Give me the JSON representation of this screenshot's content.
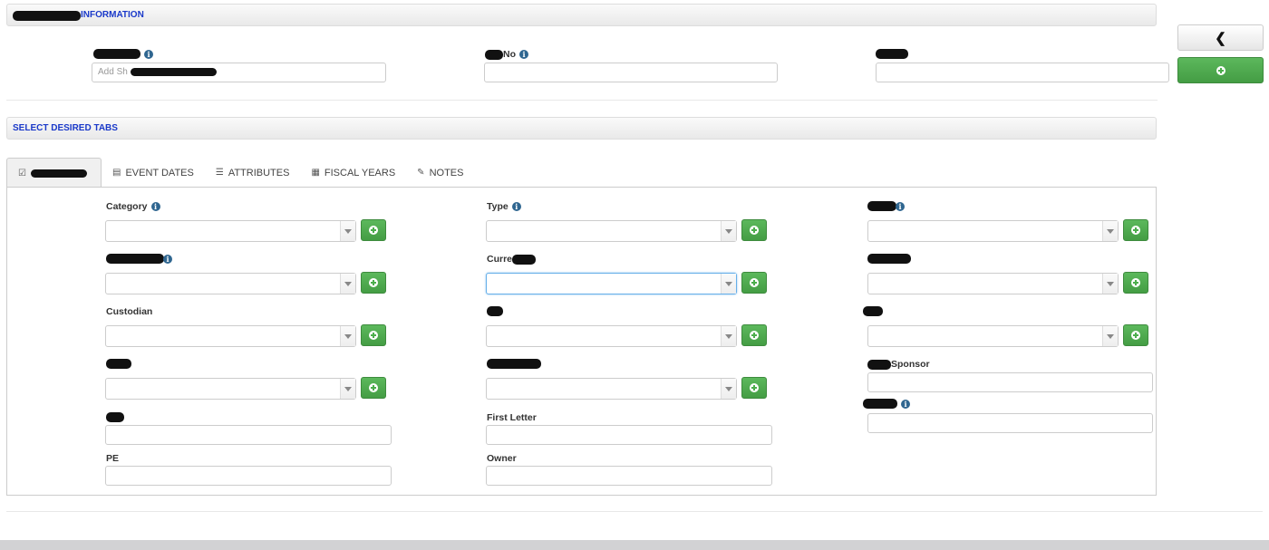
{
  "section1": {
    "title_tail": "INFORMATION"
  },
  "section2": {
    "title": "SELECT DESIRED TABS"
  },
  "top_fields": [
    {
      "label_tail": "",
      "placeholder": "Add Sh",
      "has_info": true
    },
    {
      "label_tail": "No",
      "placeholder": "",
      "has_info": true
    },
    {
      "label_tail": "",
      "placeholder": "",
      "has_info": false
    }
  ],
  "side_buttons": {
    "back_icon": "chevron-left-icon",
    "add_icon": "plus-circle-icon"
  },
  "tabs": [
    {
      "label": "",
      "icon": "check-square-icon",
      "active": true
    },
    {
      "label": "EVENT DATES",
      "icon": "calendar-icon",
      "active": false
    },
    {
      "label": "ATTRIBUTES",
      "icon": "list-icon",
      "active": false
    },
    {
      "label": "FISCAL YEARS",
      "icon": "grid-icon",
      "active": false
    },
    {
      "label": "NOTES",
      "icon": "pencil-icon",
      "active": false
    }
  ],
  "fields": {
    "category": "Category",
    "type": "Type",
    "current_prefix": "Curre",
    "custodian": "Custodian",
    "sponsor_tail": "Sponsor",
    "first_letter": "First Letter",
    "pe": "PE",
    "owner": "Owner"
  },
  "colors": {
    "section_title": "#1a39c9",
    "add_green": "#5cb85c",
    "info_icon": "#2f6690"
  }
}
